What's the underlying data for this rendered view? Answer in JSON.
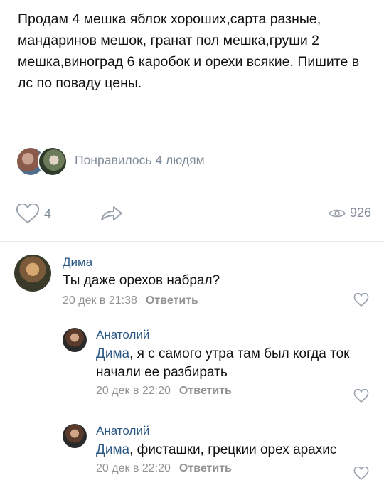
{
  "post": {
    "text": "Продам 4 мешка яблок хороших,сарта разные, мандаринов мешок, гранат пол мешка,груши 2 мешка,виноград 6 каробок и орехи всякие. Пишите в лс по поваду цены."
  },
  "likers": {
    "text": "Понравилось 4 людям"
  },
  "actions": {
    "like_count": "4",
    "views_count": "926"
  },
  "comments": [
    {
      "author": "Дима",
      "mention": "",
      "text": "Ты даже орехов набрал?",
      "date": "20 дек в 21:38",
      "reply": "Ответить"
    },
    {
      "author": "Анатолий",
      "mention": "Дима",
      "text": ", я с самого утра там был когда ток начали ее разбирать",
      "date": "20 дек в 22:20",
      "reply": "Ответить"
    },
    {
      "author": "Анатолий",
      "mention": "Дима",
      "text": ", фисташки, грецкии орех арахис",
      "date": "20 дек в 22:20",
      "reply": "Ответить"
    }
  ],
  "icons": {
    "like": "heart-icon",
    "share": "share-arrow-icon",
    "views": "eye-icon"
  },
  "colors": {
    "link": "#2a5885",
    "secondary_text": "#818c99",
    "meta_text": "#939393"
  }
}
